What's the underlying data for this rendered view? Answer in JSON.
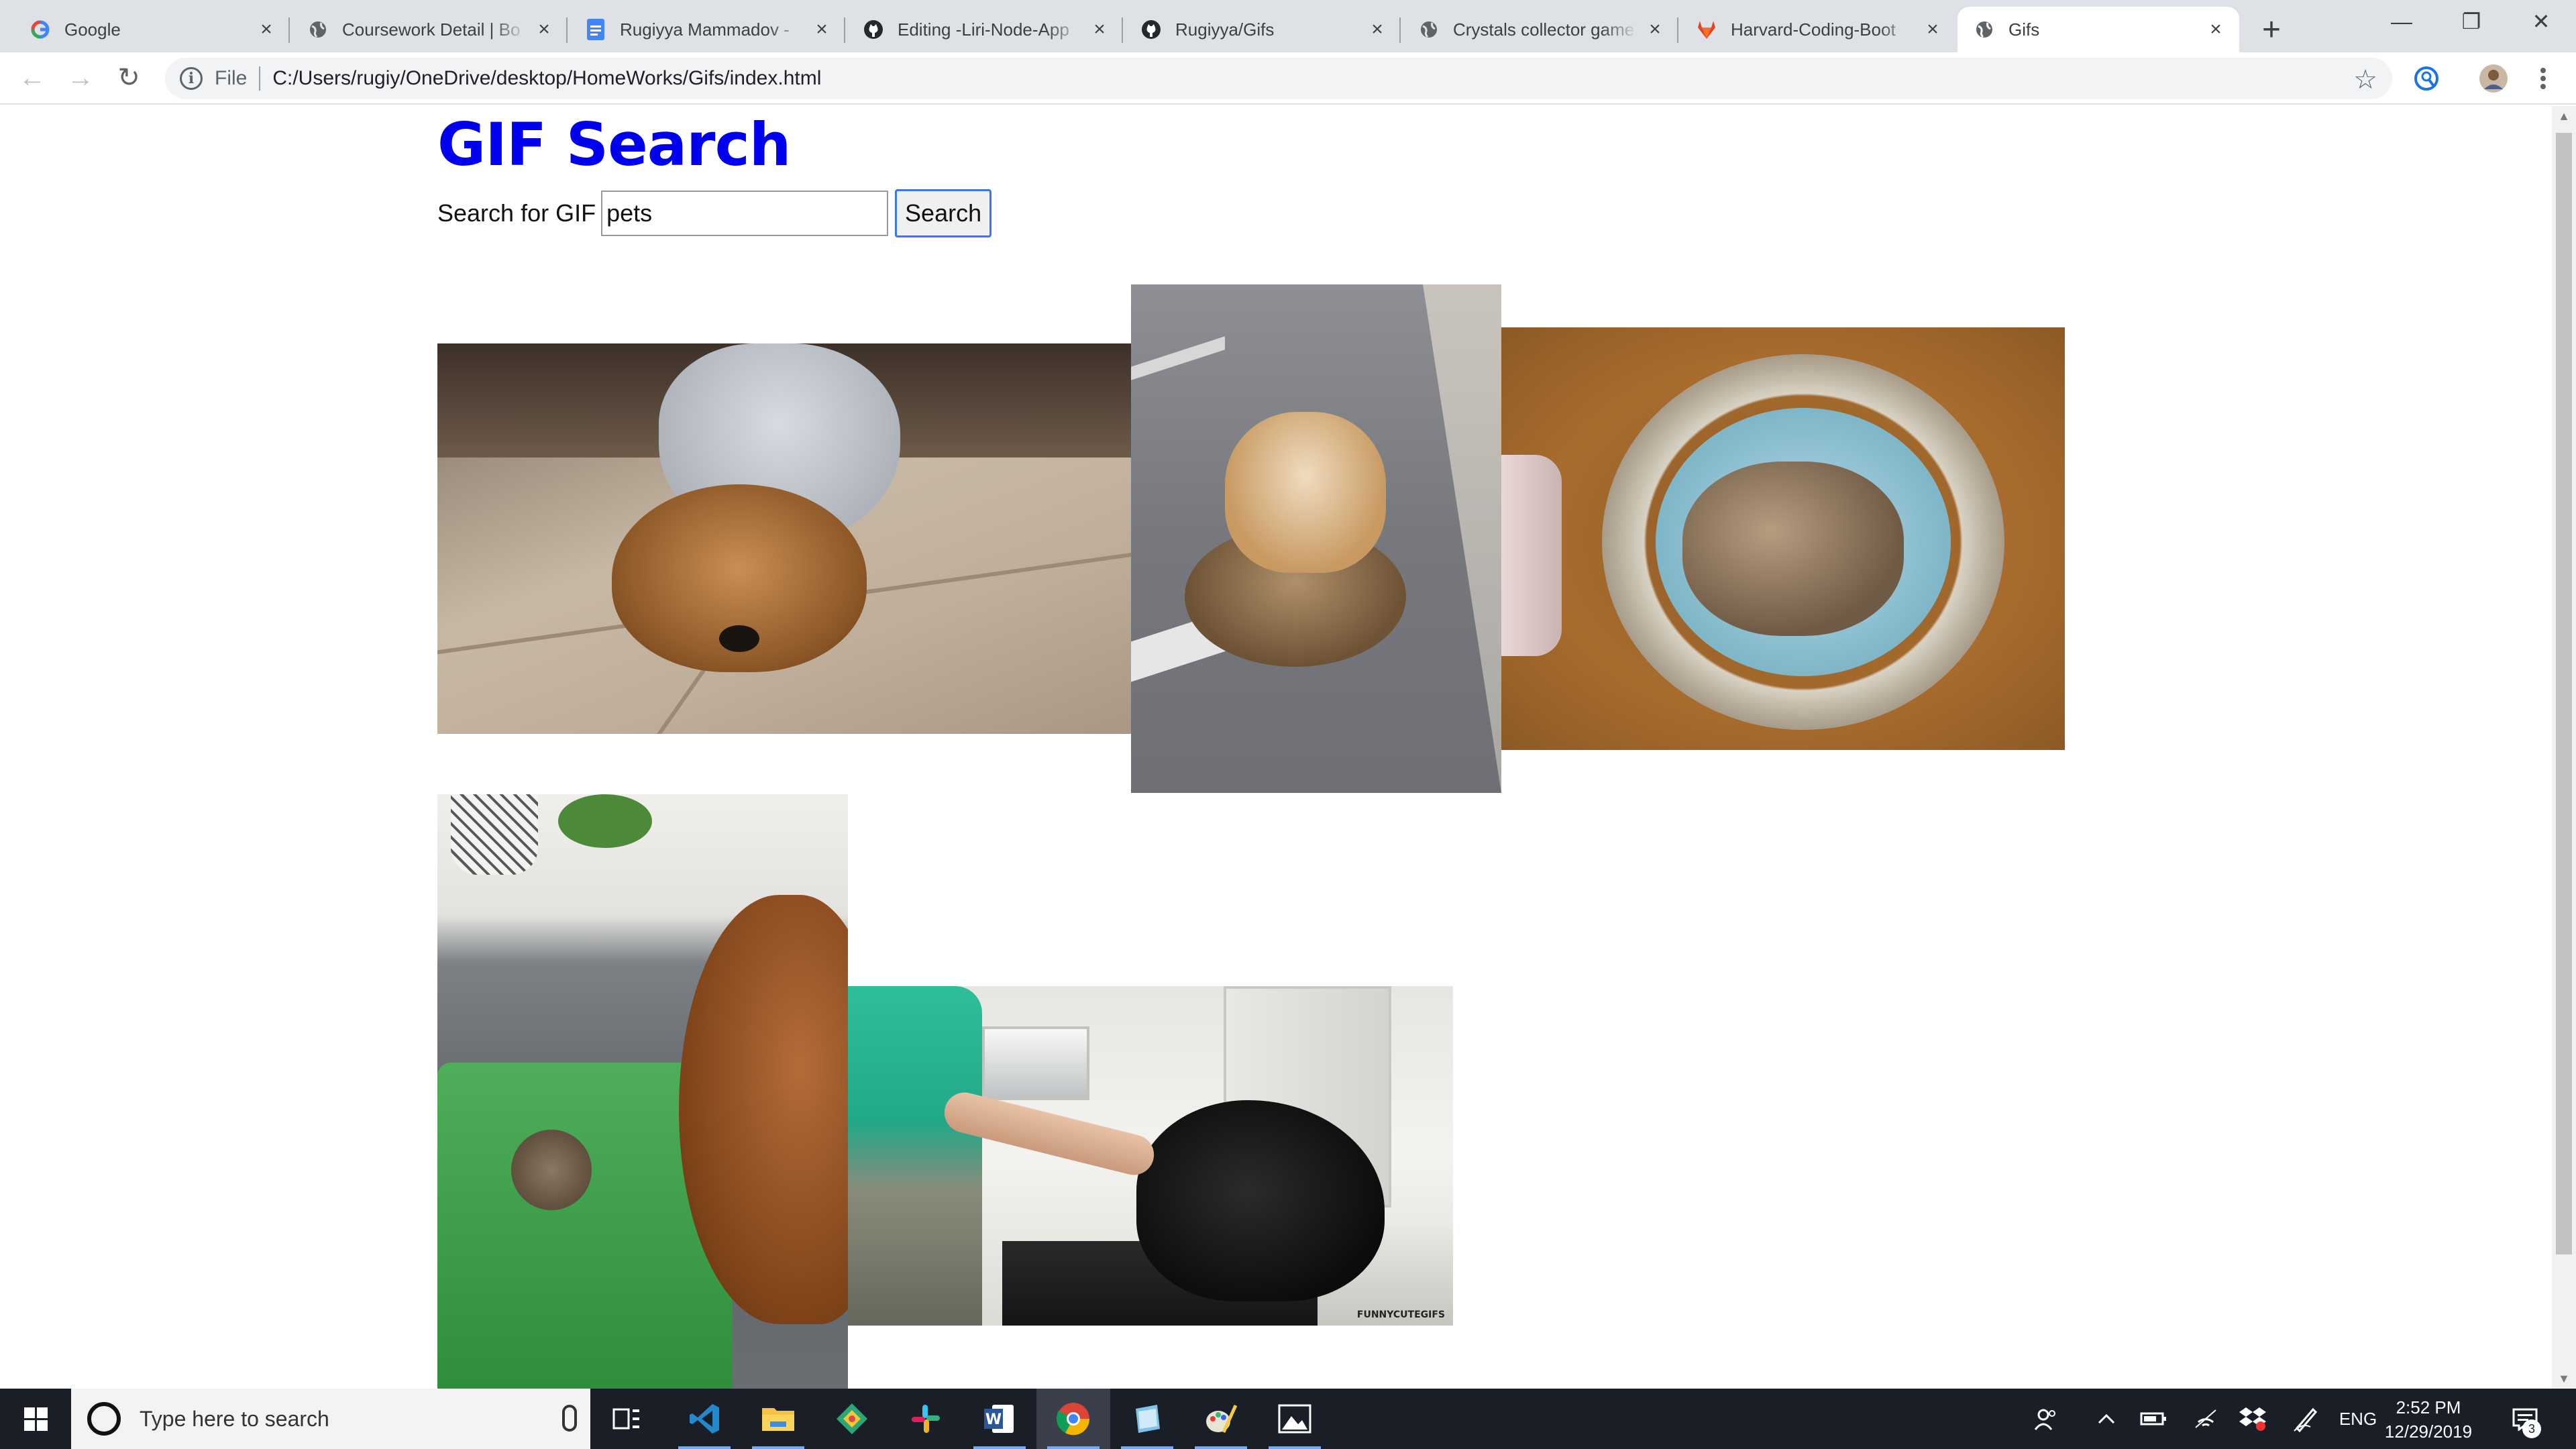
{
  "browser": {
    "tabs": [
      {
        "title": "Google",
        "favicon": "google-g-icon",
        "active": false
      },
      {
        "title": "Coursework Detail | Bo",
        "favicon": "globe-icon",
        "active": false
      },
      {
        "title": "Rugiyya Mammadov - ",
        "favicon": "google-docs-icon",
        "active": false
      },
      {
        "title": "Editing -Liri-Node-App",
        "favicon": "github-icon",
        "active": false
      },
      {
        "title": "Rugiyya/Gifs",
        "favicon": "github-icon",
        "active": false
      },
      {
        "title": "Crystals collector game",
        "favicon": "globe-icon",
        "active": false
      },
      {
        "title": "Harvard-Coding-Boot",
        "favicon": "gitlab-icon",
        "active": false
      },
      {
        "title": "Gifs",
        "favicon": "globe-icon",
        "active": true
      }
    ],
    "new_tab_symbol": "+",
    "address": {
      "scheme_label": "File",
      "url": "C:/Users/rugiy/OneDrive/desktop/HomeWorks/Gifs/index.html"
    },
    "window_controls": {
      "minimize": "—",
      "restore": "❐",
      "close": "✕"
    }
  },
  "page": {
    "title": "GIF Search",
    "search_label": "Search for GIF",
    "search_value": "pets",
    "search_button": "Search",
    "gifs": [
      {
        "name": "pomeranian-gif"
      },
      {
        "name": "shiba-tortoise-gif"
      },
      {
        "name": "kitten-basket-gif"
      },
      {
        "name": "dog-kitten-bath-gif"
      },
      {
        "name": "black-cat-gif",
        "watermark": "FUNNYCUTEGIFS"
      }
    ]
  },
  "taskbar": {
    "search_placeholder": "Type here to search",
    "language": "ENG",
    "time": "2:52 PM",
    "date": "12/29/2019",
    "notification_count": "3",
    "apps": [
      "task-view",
      "vscode",
      "file-explorer",
      "git-kraken",
      "slack",
      "word",
      "chrome",
      "notes",
      "paint",
      "photos"
    ]
  },
  "colors": {
    "title_link": "#0000ee",
    "taskbar": "#1a1e26",
    "tabstrip": "#dee1e6",
    "focus_border": "#3b78e7"
  }
}
